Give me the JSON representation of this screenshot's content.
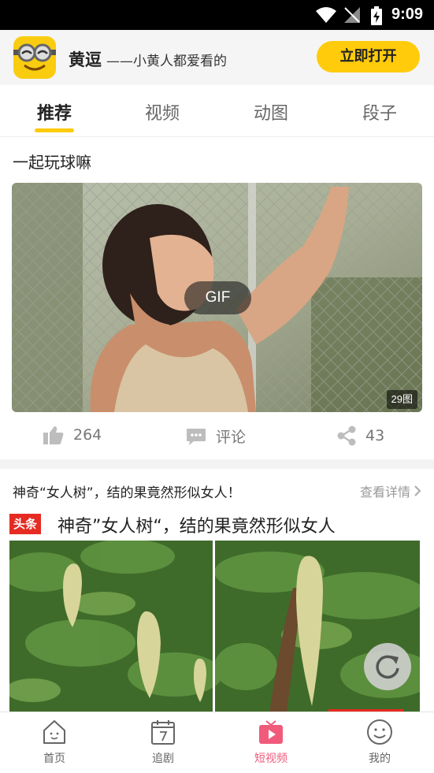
{
  "status_bar": {
    "time": "9:09"
  },
  "banner": {
    "app_name": "黄逗",
    "tagline": "——小黄人都爱看的",
    "open_button": "立即打开"
  },
  "tabs": [
    {
      "label": "推荐",
      "active": true
    },
    {
      "label": "视频",
      "active": false
    },
    {
      "label": "动图",
      "active": false
    },
    {
      "label": "段子",
      "active": false
    }
  ],
  "post": {
    "title": "一起玩球嘛",
    "media_badge": "GIF",
    "image_count": "29图",
    "likes": "264",
    "comment_label": "评论",
    "shares": "43"
  },
  "ad": {
    "title": "神奇“女人树”，结的果竟然形似女人！",
    "more_label": "查看详情",
    "source_logo": "头条",
    "headline": "神奇”女人树“，结的果竟然形似女人"
  },
  "bottom_nav": [
    {
      "label": "首页",
      "icon": "home-icon",
      "active": false
    },
    {
      "label": "追剧",
      "icon": "calendar-icon",
      "active": false
    },
    {
      "label": "短视频",
      "icon": "play-video-icon",
      "active": true
    },
    {
      "label": "我的",
      "icon": "smiley-icon",
      "active": false
    }
  ],
  "colors": {
    "accent_yellow": "#ffcb0b",
    "active_nav_pink": "#f05b7c",
    "headline_red": "#e52b22"
  }
}
